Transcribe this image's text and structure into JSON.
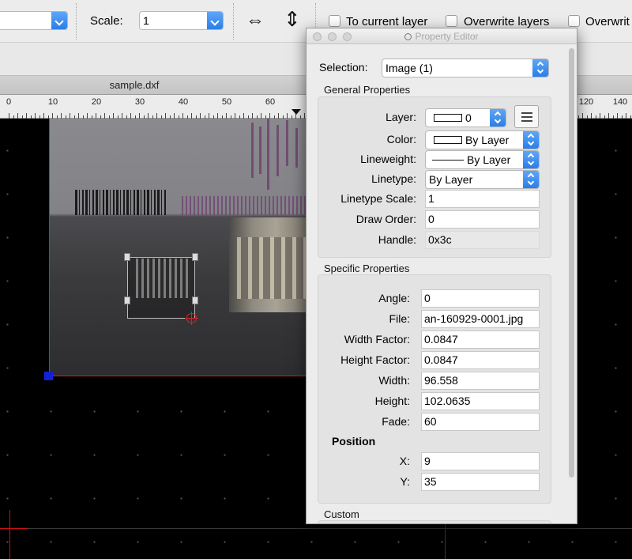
{
  "toolbar": {
    "left_combo_value": "",
    "scale_label": "Scale:",
    "scale_value": "1",
    "flip_horizontal_icon": "horizontal-arrows-icon",
    "flip_vertical_icon": "vertical-arrows-icon",
    "to_current_layer_label": "To current layer",
    "overwrite_layers_label": "Overwrite layers",
    "overwrite_blocks_label": "Overwrit"
  },
  "tab": {
    "title": "sample.dxf"
  },
  "ruler": {
    "labels": [
      "0",
      "10",
      "20",
      "30",
      "40",
      "50",
      "60",
      "120",
      "140"
    ]
  },
  "property_editor": {
    "title": "Property Editor",
    "selection_label": "Selection:",
    "selection_value": "Image (1)",
    "general": {
      "title": "General Properties",
      "layer_label": "Layer:",
      "layer_value": "0",
      "color_label": "Color:",
      "color_value": "By Layer",
      "lineweight_label": "Lineweight:",
      "lineweight_value": "By Layer",
      "linetype_label": "Linetype:",
      "linetype_value": "By Layer",
      "linetype_scale_label": "Linetype Scale:",
      "linetype_scale_value": "1",
      "draw_order_label": "Draw Order:",
      "draw_order_value": "0",
      "handle_label": "Handle:",
      "handle_value": "0x3c"
    },
    "specific": {
      "title": "Specific Properties",
      "angle_label": "Angle:",
      "angle_value": "0",
      "file_label": "File:",
      "file_value": "an-160929-0001.jpg",
      "width_factor_label": "Width Factor:",
      "width_factor_value": "0.0847",
      "height_factor_label": "Height Factor:",
      "height_factor_value": "0.0847",
      "width_label": "Width:",
      "width_value": "96.558",
      "height_label": "Height:",
      "height_value": "102.0635",
      "fade_label": "Fade:",
      "fade_value": "60",
      "position_title": "Position",
      "x_label": "X:",
      "x_value": "9",
      "y_label": "Y:",
      "y_value": "35"
    },
    "custom": {
      "title": "Custom"
    }
  }
}
